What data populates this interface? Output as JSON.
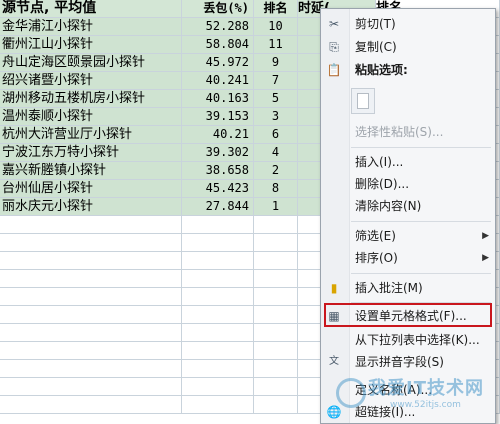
{
  "sheet": {
    "header": {
      "col_name": "源节点, 平均值",
      "col_value": "丢包(%)",
      "col_rank": "排名",
      "col_time": "时延(",
      "col_rank2": "排名"
    },
    "rows": [
      {
        "name": "金华浦江小探针",
        "value": "52.288",
        "rank": "10"
      },
      {
        "name": "衢州江山小探针",
        "value": "58.804",
        "rank": "11"
      },
      {
        "name": "舟山定海区颐景园小探针",
        "value": "45.972",
        "rank": "9"
      },
      {
        "name": "绍兴诸暨小探针",
        "value": "40.241",
        "rank": "7"
      },
      {
        "name": "湖州移动五楼机房小探针",
        "value": "40.163",
        "rank": "5"
      },
      {
        "name": "温州泰顺小探针",
        "value": "39.153",
        "rank": "3"
      },
      {
        "name": "杭州大浒营业厅小探针",
        "value": "40.21",
        "rank": "6"
      },
      {
        "name": "宁波江东万特小探针",
        "value": "39.302",
        "rank": "4"
      },
      {
        "name": "嘉兴新塍镇小探针",
        "value": "38.658",
        "rank": "2"
      },
      {
        "name": "台州仙居小探针",
        "value": "45.423",
        "rank": "8"
      },
      {
        "name": "丽水庆元小探针",
        "value": "27.844",
        "rank": "1"
      }
    ]
  },
  "menu": {
    "cut": "剪切(T)",
    "copy": "复制(C)",
    "paste_options": "粘贴选项:",
    "paste_special": "选择性粘贴(S)...",
    "insert": "插入(I)...",
    "delete": "删除(D)...",
    "clear": "清除内容(N)",
    "filter": "筛选(E)",
    "sort": "排序(O)",
    "insert_comment": "插入批注(M)",
    "format_cells": "设置单元格格式(F)...",
    "pick_list": "从下拉列表中选择(K)...",
    "phonetic": "显示拼音字段(S)",
    "define_name": "定义名称(A)...",
    "hyperlink": "超链接(I)..."
  },
  "watermark": {
    "text": "我爱IT技术网",
    "url": "www.52itjs.com"
  }
}
